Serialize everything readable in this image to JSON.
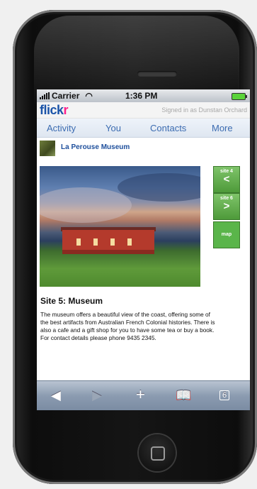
{
  "status_bar": {
    "carrier": "Carrier",
    "time": "1:36 PM"
  },
  "header": {
    "logo_main": "flick",
    "logo_r": "r",
    "signed_in": "Signed in as Dunstan Orchard"
  },
  "nav": {
    "items": [
      "Activity",
      "You",
      "Contacts",
      "More"
    ]
  },
  "profile": {
    "name": "La Perouse Museum"
  },
  "side_buttons": {
    "prev": {
      "label": "site 4",
      "arrow": "<"
    },
    "next": {
      "label": "site 6",
      "arrow": ">"
    },
    "map": {
      "label": "map"
    }
  },
  "content": {
    "title": "Site 5: Museum",
    "description": "The museum offers a beautiful view of the coast, offering some of the best artifacts from Australian French Colonial histories. There is also a cafe and a gift shop for you to have some tea or buy a book. For contact details please phone 9435 2345."
  },
  "toolbar": {
    "tabs_count": "6"
  },
  "icons": {
    "back": "back-icon",
    "forward": "forward-icon",
    "add": "plus-icon",
    "bookmarks": "bookmarks-icon",
    "pages": "pages-icon",
    "wifi": "wifi-icon"
  },
  "colors": {
    "flickr_blue": "#1a53a8",
    "flickr_pink": "#ff1f8a",
    "green": "#5ab54a"
  }
}
